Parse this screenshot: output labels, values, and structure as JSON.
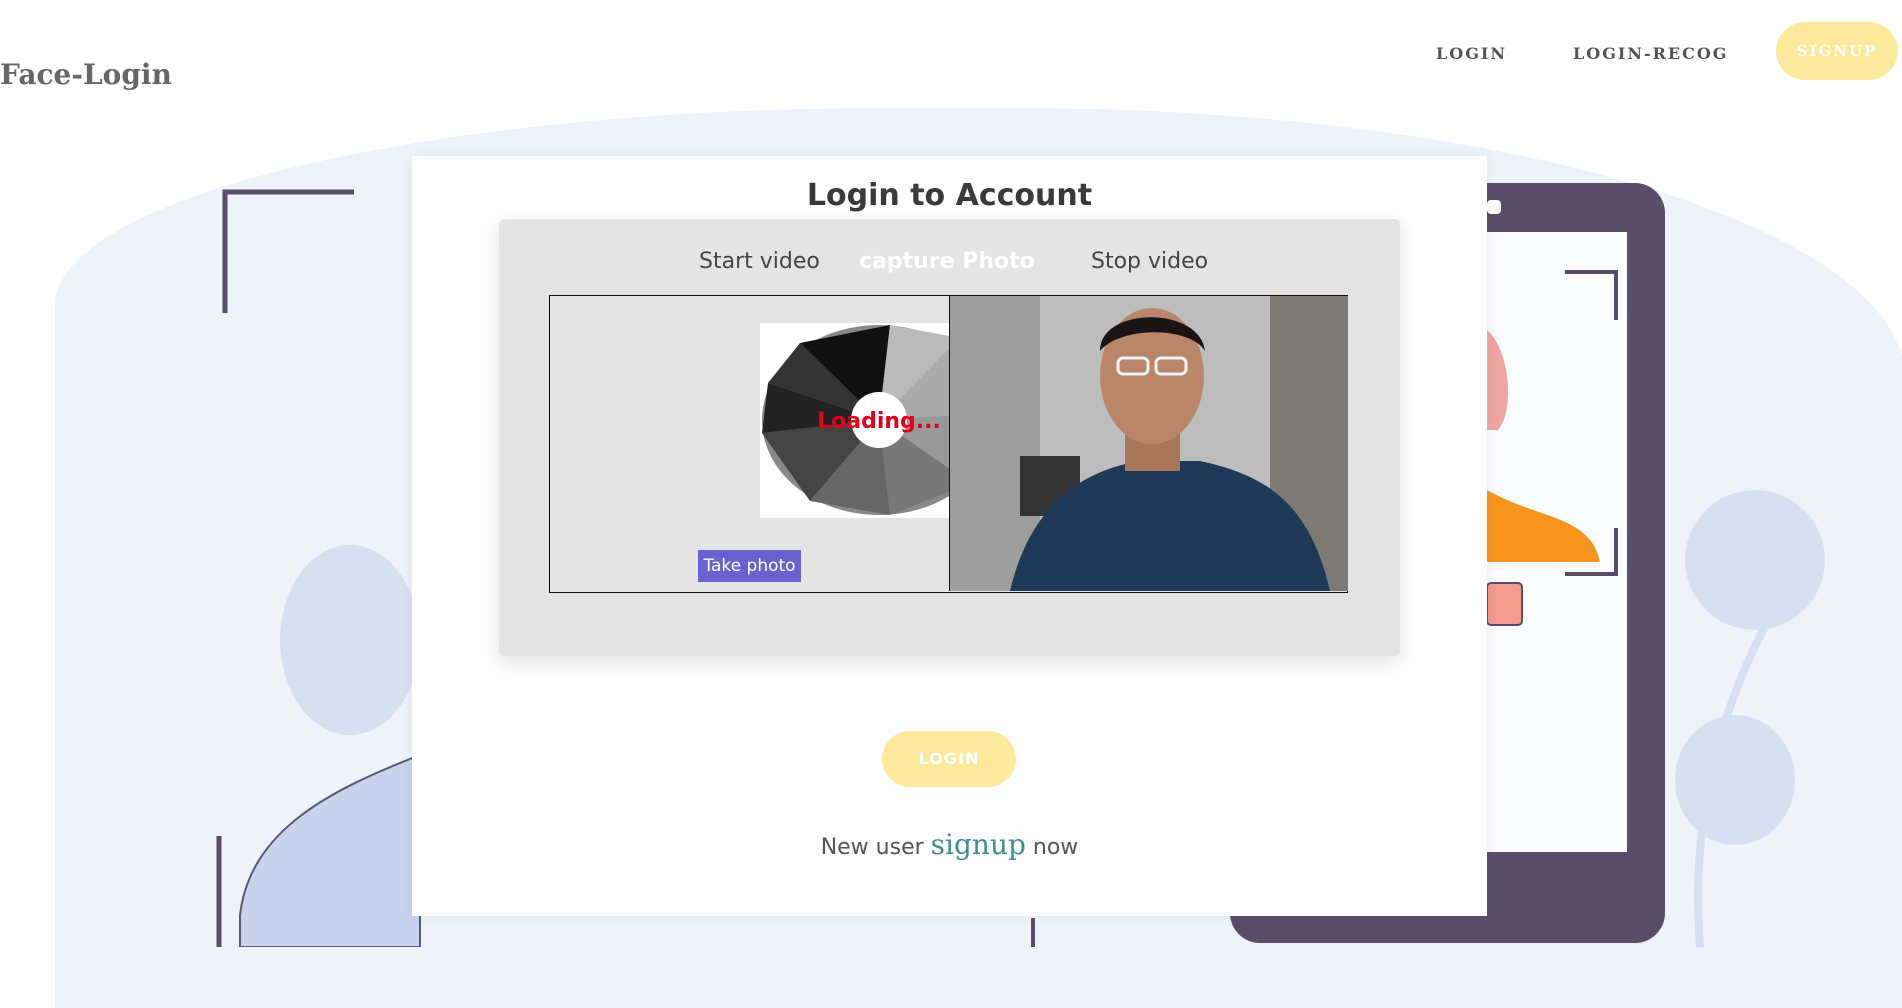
{
  "header": {
    "brand": "Face-Login",
    "nav": {
      "login": "LOGIN",
      "login_recog": "LOGIN-RECOG",
      "signup": "SIGNUP"
    }
  },
  "card": {
    "title": "Login to Account",
    "controls": {
      "start_video": "Start video",
      "capture_photo": "capture Photo",
      "stop_video": "Stop video"
    },
    "capture_panel": {
      "loading_text": "Loading...",
      "take_photo": "Take photo"
    },
    "login_button": "LOGIN",
    "footer": {
      "prefix": "New user",
      "link": "signup",
      "suffix": "now"
    }
  },
  "colors": {
    "accent_yellow": "#fde99b",
    "take_photo_bg": "#6a61d1",
    "signup_link": "#3e8f90",
    "loading_text": "#e3001b",
    "background_blob": "#eef3fa"
  }
}
